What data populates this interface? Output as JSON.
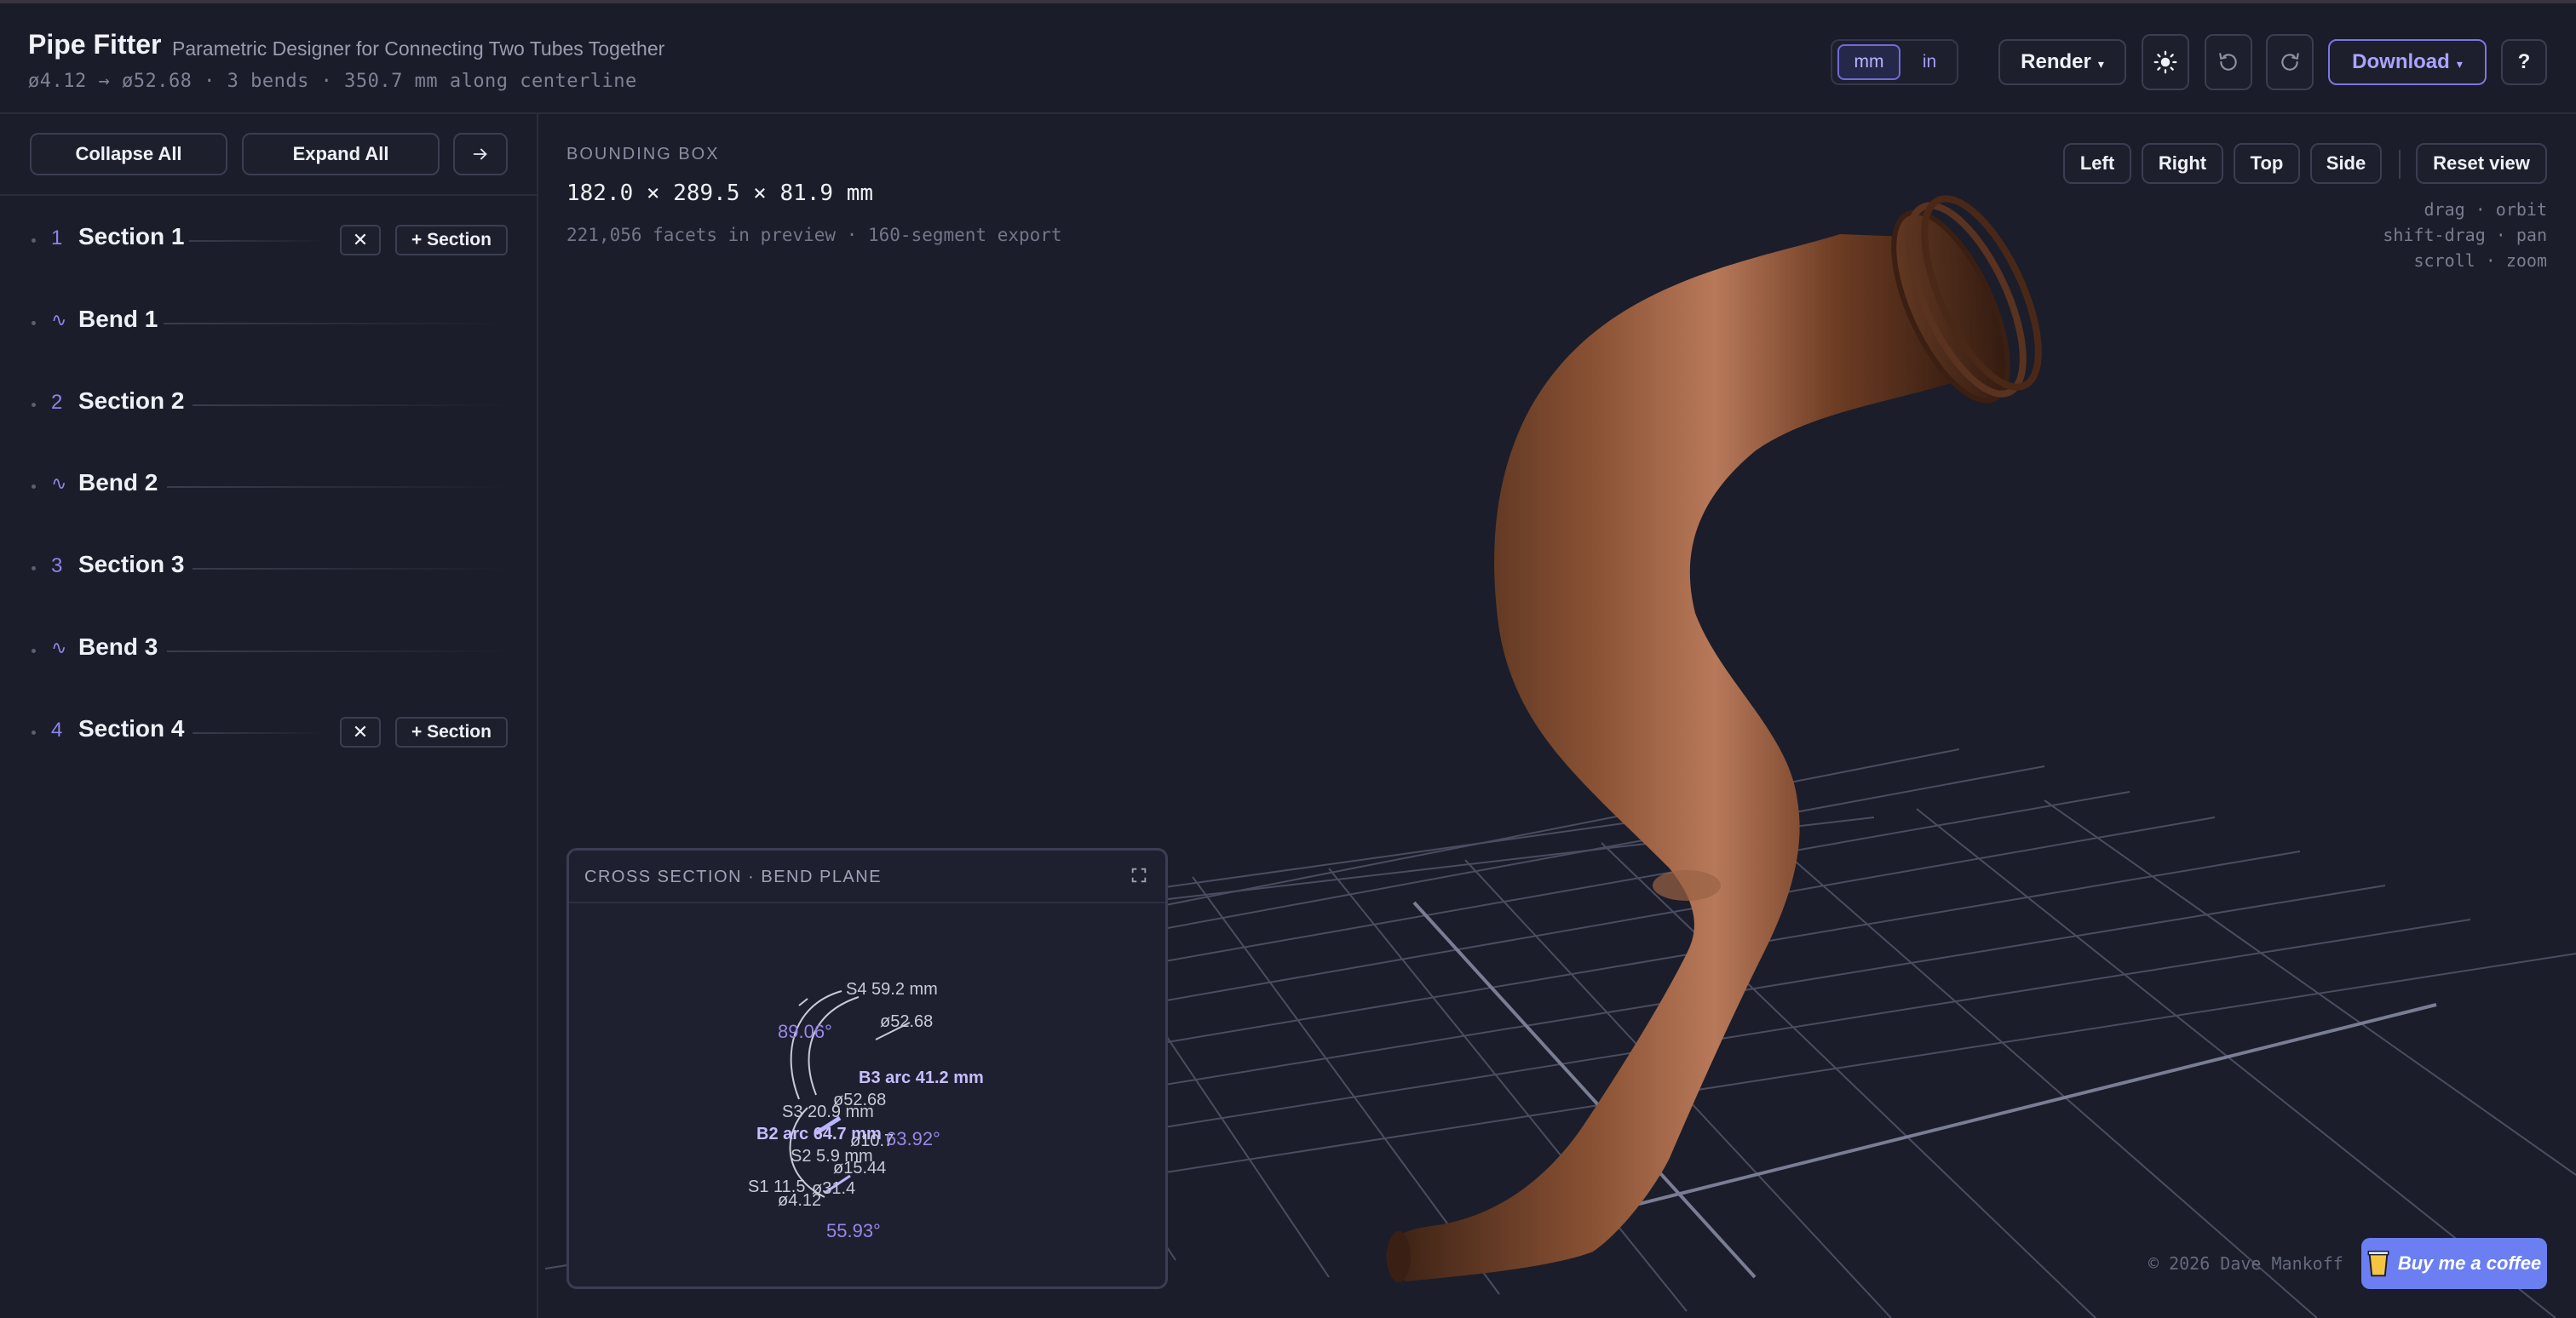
{
  "header": {
    "title": "Pipe Fitter",
    "subtitle": "Parametric Designer for Connecting Two Tubes Together",
    "summary": "ø4.12 → ø52.68 · 3 bends · 350.7 mm along centerline",
    "units": {
      "mm": "mm",
      "in": "in",
      "selected": "mm"
    },
    "render_label": "Render",
    "download_label": "Download",
    "help_label": "?"
  },
  "sidebar": {
    "collapse_all": "Collapse All",
    "expand_all": "Expand All",
    "items": [
      {
        "index": "1",
        "label": "Section 1",
        "kind": "section",
        "remove": "✕",
        "add": "+ Section"
      },
      {
        "index": "",
        "label": "Bend 1",
        "kind": "bend"
      },
      {
        "index": "2",
        "label": "Section 2",
        "kind": "section"
      },
      {
        "index": "",
        "label": "Bend 2",
        "kind": "bend"
      },
      {
        "index": "3",
        "label": "Section 3",
        "kind": "section"
      },
      {
        "index": "",
        "label": "Bend 3",
        "kind": "bend"
      },
      {
        "index": "4",
        "label": "Section 4",
        "kind": "section",
        "remove": "✕",
        "add": "+ Section"
      }
    ]
  },
  "viewport": {
    "bbox_label": "BOUNDING BOX",
    "bbox_value": "182.0 × 289.5 × 81.9 mm",
    "facets": "221,056 facets in preview · 160-segment export",
    "view_buttons": {
      "left": "Left",
      "right": "Right",
      "top": "Top",
      "side": "Side",
      "reset": "Reset view"
    },
    "hints": [
      "drag · orbit",
      "shift-drag · pan",
      "scroll · zoom"
    ],
    "pipe_color": "#7a4a2e",
    "grid_color": "#5a5d72"
  },
  "cross_section": {
    "title": "CROSS SECTION · BEND PLANE",
    "labels": {
      "s4": "S4 59.2 mm",
      "d4": "ø52.68",
      "a1": "89.06°",
      "b3": "B3 arc 41.2 mm",
      "d3": "ø52.68",
      "s3": "S3 20.9 mm",
      "b2": "B2 arc 64.7 mm",
      "d2": "ø10.7",
      "a2": "63.92°",
      "s2": "S2 5.9 mm",
      "d15": "ø15.44",
      "s1": "S1 11.5",
      "d31": "ø31.4",
      "d4s": "ø4.12",
      "a3": "55.93°"
    }
  },
  "footer": {
    "credit": "© 2026 Dave Mankoff",
    "coffee": "Buy me a coffee"
  }
}
